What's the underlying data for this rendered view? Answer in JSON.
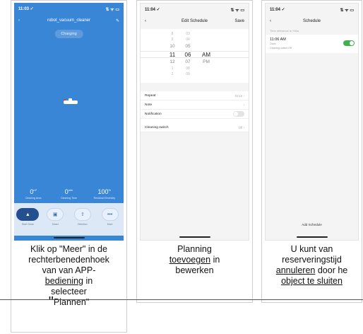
{
  "screen1": {
    "status_time": "11:03 ✓",
    "status_icons": "⇅ ᯤ ▭",
    "title": "robot_vacuum_cleaner",
    "back_icon": "chevron-left-icon",
    "edit_icon": "pencil-icon",
    "charging_label": "Charging",
    "stats": [
      {
        "value": "0",
        "unit": "m²",
        "label": "Cleaning Area"
      },
      {
        "value": "0",
        "unit": "min",
        "label": "Cleaning Time"
      },
      {
        "value": "100",
        "unit": "%",
        "label": "Residual Electricity"
      }
    ],
    "actions": [
      {
        "icon": "broom-icon",
        "glyph": "▲",
        "label": "Start Clean"
      },
      {
        "icon": "smart-icon",
        "glyph": "▣",
        "label": "Smart"
      },
      {
        "icon": "direction-icon",
        "glyph": "⇧",
        "label": "Direction"
      },
      {
        "icon": "more-icon",
        "glyph": "•••",
        "label": "More"
      }
    ],
    "caption": {
      "p1": "Klik op \"Meer\"",
      "p2": " in de",
      "p3": "rechterbenedenhoek",
      "p4": "van van APP-",
      "p5": "bediening",
      "p6": " in",
      "p7": "selecteer",
      "p8": "\"",
      "p9": "Plannen\""
    }
  },
  "screen2": {
    "status_time": "11:04 ✓",
    "status_icons": "⇅ ᯤ ▭",
    "title": "Edit Schedule",
    "save_label": "Save",
    "picker_rows": [
      {
        "h": "8",
        "m": "03",
        "ap": ""
      },
      {
        "h": "9",
        "m": "04",
        "ap": ""
      },
      {
        "h": "10",
        "m": "05",
        "ap": ""
      },
      {
        "h": "11",
        "m": "06",
        "ap": "AM"
      },
      {
        "h": "12",
        "m": "07",
        "ap": "PM"
      },
      {
        "h": "1",
        "m": "08",
        "ap": ""
      },
      {
        "h": "2",
        "m": "09",
        "ap": ""
      }
    ],
    "settings": [
      {
        "label": "Repeat",
        "value": "Once"
      },
      {
        "label": "Note",
        "value": ""
      },
      {
        "label": "Notification",
        "value": ""
      },
      {
        "label": "Cleaning switch",
        "value": "Off"
      }
    ],
    "caption": {
      "p1": "Planning",
      "p2": "toevoegen",
      "p3": " in",
      "p4": "bewerken"
    }
  },
  "screen3": {
    "status_time": "11:04 ✓",
    "status_icons": "⇅ ᯤ ▭",
    "title": "Schedule",
    "timezone_note": "Time reference is +08a",
    "item_time": "11:06 AM",
    "item_repeat": "Once",
    "item_detail": "Cleaning switch:Off",
    "add_schedule": "Add Schedule",
    "caption": {
      "p1": "U kunt van",
      "p2": "reserveringstijd",
      "p3": "annuleren",
      "p4": " door he",
      "p5": "object te sluiten"
    }
  }
}
